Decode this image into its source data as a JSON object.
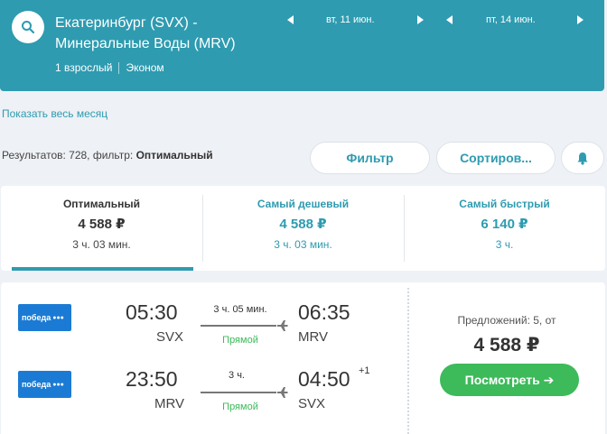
{
  "header": {
    "route_line1": "Екатеринбург (SVX) -",
    "route_line2": "Минеральные Воды (MRV)",
    "passengers": "1 взрослый",
    "cabin": "Эконом",
    "depart_date": "вт, 11 июн.",
    "return_date": "пт, 14 июн."
  },
  "links": {
    "show_month": "Показать весь месяц"
  },
  "results": {
    "prefix": "Результатов: 728, фильтр: ",
    "filter_name": "Оптимальный"
  },
  "actions": {
    "filter_label": "Фильтр",
    "sort_label": "Сортиров..."
  },
  "tabs": [
    {
      "title": "Оптимальный",
      "price": "4 588 ₽",
      "duration": "3 ч. 03 мин.",
      "active": true
    },
    {
      "title": "Самый дешевый",
      "price": "4 588 ₽",
      "duration": "3 ч. 03 мин.",
      "active": false
    },
    {
      "title": "Самый быстрый",
      "price": "6 140 ₽",
      "duration": "3 ч.",
      "active": false
    }
  ],
  "ticket": {
    "outbound": {
      "airline": "победа",
      "dep_time": "05:30",
      "dep_code": "SVX",
      "duration": "3 ч. 05 мин.",
      "stops": "Прямой",
      "arr_time": "06:35",
      "arr_code": "MRV"
    },
    "inbound": {
      "airline": "победа",
      "dep_time": "23:50",
      "dep_code": "MRV",
      "duration": "3 ч.",
      "stops": "Прямой",
      "arr_time": "04:50",
      "arr_day_offset": "+1",
      "arr_code": "SVX"
    },
    "offers": "Предложений: 5, от",
    "price": "4 588 ₽",
    "view_label": "Посмотреть ➔"
  },
  "colors": {
    "brand": "#2e9bb0",
    "green": "#3dba5a",
    "airline_blue": "#1b7bd4"
  }
}
